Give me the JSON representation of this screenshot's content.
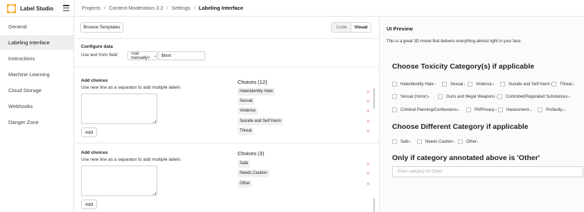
{
  "app": {
    "name": "Label Studio",
    "accent": "#f5a623"
  },
  "breadcrumb": {
    "items": [
      "Projects",
      "Content Moderation 3.2",
      "Settings",
      "Labeling Interface"
    ],
    "separator": "/"
  },
  "sidebar": {
    "items": [
      {
        "label": "General"
      },
      {
        "label": "Labeling Interface",
        "active": true
      },
      {
        "label": "Instructions"
      },
      {
        "label": "Machine Learning"
      },
      {
        "label": "Cloud Storage"
      },
      {
        "label": "Webhooks"
      },
      {
        "label": "Danger Zone"
      }
    ]
  },
  "editor": {
    "browse_templates": "Browse Templates",
    "mode_toggle": {
      "code": "Code",
      "visual": "Visual",
      "selected": "Visual"
    },
    "configure": {
      "title": "Configure data",
      "field_label": "Use text from field",
      "field_select": "<set manually>",
      "field_value": "$text"
    },
    "choice_blocks": [
      {
        "title": "Add choices",
        "hint": "Use new line as a separator to add multiple labels",
        "add_button": "Add",
        "list_title": "Choices (12)",
        "choices": [
          "Hate/Identity Hate",
          "Sexual",
          "Violence",
          "Suicide and Self Harm",
          "Threat"
        ]
      },
      {
        "title": "Add choices",
        "hint": "Use new line as a separator to add multiple labels",
        "add_button": "Add",
        "list_title": "Choices (3)",
        "choices": [
          "Safe",
          "Needs Caution",
          "Other"
        ]
      }
    ],
    "delete_icon": "×"
  },
  "preview": {
    "title": "UI Preview",
    "text": "This is a great 3D movie that delivers everything almost right in your face.",
    "groups": [
      {
        "heading": "Choose Toxicity Category(s) if applicable",
        "options": [
          {
            "label": "Hate/Identity Hate",
            "hotkey": "1"
          },
          {
            "label": "Sexual",
            "hotkey": "2"
          },
          {
            "label": "Violence",
            "hotkey": "3"
          },
          {
            "label": "Suicide and Self Harm",
            "hotkey": "4"
          },
          {
            "label": "Threat",
            "hotkey": "5"
          },
          {
            "label": "Sexual (minor)",
            "hotkey": "6"
          },
          {
            "label": "Guns and Illegal Weapons",
            "hotkey": "7"
          },
          {
            "label": "Controlled/Regulated Substances",
            "hotkey": "8"
          },
          {
            "label": "Criminal Planning/Confessions",
            "hotkey": "9"
          },
          {
            "label": "PII/Privacy",
            "hotkey": "0"
          },
          {
            "label": "Harassment",
            "hotkey": "q"
          },
          {
            "label": "Profanity",
            "hotkey": "w"
          }
        ]
      },
      {
        "heading": "Choose Different Category if applicable",
        "options": [
          {
            "label": "Safe",
            "hotkey": "e"
          },
          {
            "label": "Needs Caution",
            "hotkey": "r"
          },
          {
            "label": "Other",
            "hotkey": "t"
          }
        ]
      },
      {
        "heading": "Only if category annotated above is 'Other'",
        "input_placeholder": "Enter category for Other"
      }
    ]
  }
}
